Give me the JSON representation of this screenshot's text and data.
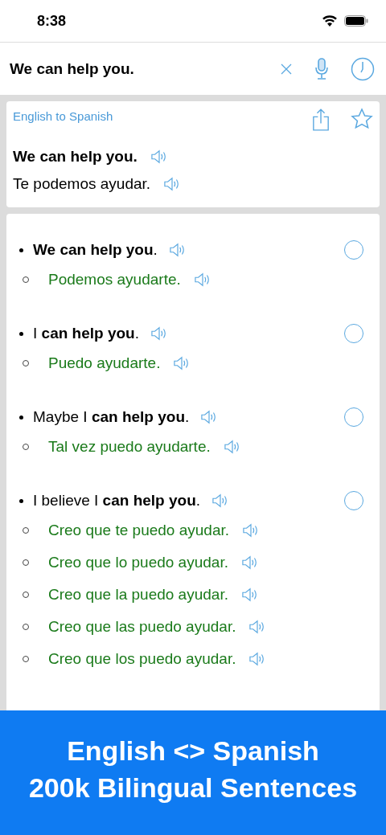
{
  "status_bar": {
    "time": "8:38"
  },
  "search": {
    "value": "We can help you."
  },
  "translation": {
    "direction": "English to Spanish",
    "source": "We can help you.",
    "target": "Te podemos ayudar."
  },
  "results": [
    {
      "english": "**We can help you**.",
      "selected": false,
      "spanish": [
        "Podemos ayudarte."
      ]
    },
    {
      "english": "I **can help you**.",
      "selected": false,
      "spanish": [
        "Puedo ayudarte."
      ]
    },
    {
      "english": "Maybe I **can help you**.",
      "selected": false,
      "spanish": [
        "Tal vez puedo ayudarte."
      ]
    },
    {
      "english": "I believe I **can help you**.",
      "selected": false,
      "spanish": [
        "Creo que te puedo ayudar.",
        "Creo que lo puedo ayudar.",
        "Creo que la puedo ayudar.",
        "Creo que las puedo ayudar.",
        "Creo que los puedo ayudar."
      ]
    }
  ],
  "banner": {
    "lines": [
      "English <> Spanish",
      "200k Bilingual Sentences"
    ]
  }
}
